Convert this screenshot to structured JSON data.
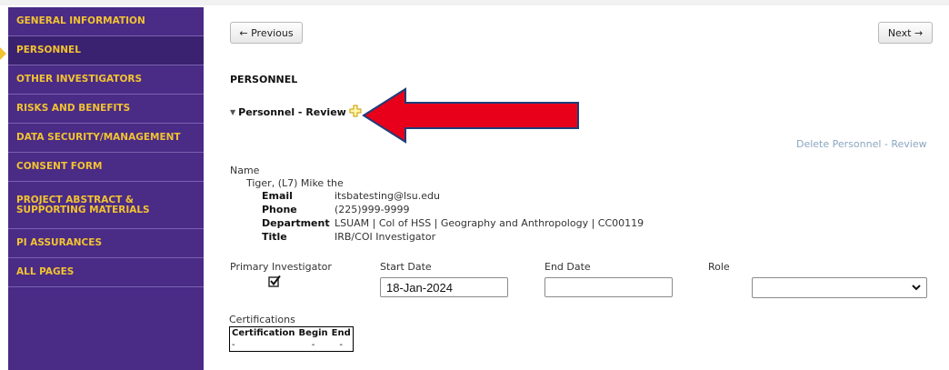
{
  "sidebar": {
    "items": [
      {
        "label": "GENERAL INFORMATION"
      },
      {
        "label": "PERSONNEL"
      },
      {
        "label": "OTHER INVESTIGATORS"
      },
      {
        "label": "RISKS AND BENEFITS"
      },
      {
        "label": "DATA SECURITY/MANAGEMENT"
      },
      {
        "label": "CONSENT FORM"
      },
      {
        "label": "PROJECT ABSTRACT & SUPPORTING MATERIALS"
      },
      {
        "label": "PI ASSURANCES"
      },
      {
        "label": "ALL PAGES"
      }
    ]
  },
  "nav": {
    "previous_label": "← Previous",
    "next_label": "Next →"
  },
  "section": {
    "title": "PERSONNEL",
    "subsection_title": "Personnel - Review",
    "delete_link": "Delete Personnel - Review"
  },
  "person": {
    "name_label": "Name",
    "name": "Tiger, (L7) Mike the",
    "email_label": "Email",
    "email": "itsbatesting@lsu.edu",
    "phone_label": "Phone",
    "phone": "(225)999-9999",
    "department_label": "Department",
    "department": "LSUAM | Col of HSS | Geography and Anthropology | CC00119",
    "title_label": "Title",
    "title": "IRB/COI Investigator"
  },
  "roles": {
    "pi_label": "Primary Investigator",
    "pi_checked": true,
    "start_label": "Start Date",
    "start_value": "18-Jan-2024",
    "end_label": "End Date",
    "end_value": "",
    "role_label": "Role",
    "role_value": ""
  },
  "certifications": {
    "label": "Certifications",
    "headers": [
      "Certification",
      "Begin",
      "End"
    ],
    "row": [
      "-",
      "-",
      "-"
    ]
  },
  "colors": {
    "sidebar": "#4a2b86",
    "sidebar_text": "#f2c331",
    "annotation_arrow": "#e8001b",
    "link": "#8aa6bf"
  }
}
